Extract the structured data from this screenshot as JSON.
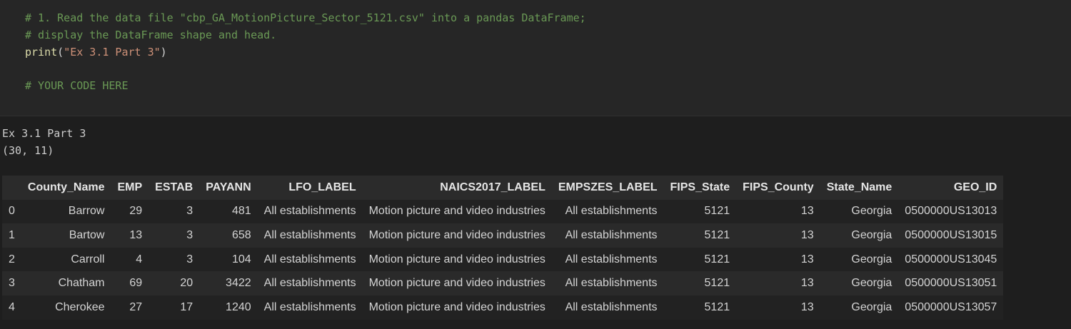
{
  "code": {
    "comment1": "# 1. Read the data file \"cbp_GA_MotionPicture_Sector_5121.csv\" into a pandas DataFrame;",
    "comment2": "# display the DataFrame shape and head.",
    "print_fn": "print",
    "print_open": "(",
    "print_arg": "\"Ex 3.1 Part 3\"",
    "print_close": ")",
    "comment3": "# YOUR CODE HERE"
  },
  "output": {
    "line1": "Ex 3.1 Part 3",
    "line2": "(30, 11)"
  },
  "dataframe": {
    "index_header": "",
    "columns": [
      "County_Name",
      "EMP",
      "ESTAB",
      "PAYANN",
      "LFO_LABEL",
      "NAICS2017_LABEL",
      "EMPSZES_LABEL",
      "FIPS_State",
      "FIPS_County",
      "State_Name",
      "GEO_ID"
    ],
    "rows": [
      {
        "index": "0",
        "cells": [
          "Barrow",
          "29",
          "3",
          "481",
          "All establishments",
          "Motion picture and video industries",
          "All establishments",
          "5121",
          "13",
          "Georgia",
          "0500000US13013"
        ]
      },
      {
        "index": "1",
        "cells": [
          "Bartow",
          "13",
          "3",
          "658",
          "All establishments",
          "Motion picture and video industries",
          "All establishments",
          "5121",
          "13",
          "Georgia",
          "0500000US13015"
        ]
      },
      {
        "index": "2",
        "cells": [
          "Carroll",
          "4",
          "3",
          "104",
          "All establishments",
          "Motion picture and video industries",
          "All establishments",
          "5121",
          "13",
          "Georgia",
          "0500000US13045"
        ]
      },
      {
        "index": "3",
        "cells": [
          "Chatham",
          "69",
          "20",
          "3422",
          "All establishments",
          "Motion picture and video industries",
          "All establishments",
          "5121",
          "13",
          "Georgia",
          "0500000US13051"
        ]
      },
      {
        "index": "4",
        "cells": [
          "Cherokee",
          "27",
          "17",
          "1240",
          "All establishments",
          "Motion picture and video industries",
          "All establishments",
          "5121",
          "13",
          "Georgia",
          "0500000US13057"
        ]
      }
    ]
  },
  "colors": {
    "background": "#1e1e1e",
    "cell_background": "#262626",
    "comment": "#6a9955",
    "function": "#dcdcaa",
    "string": "#ce9178"
  }
}
